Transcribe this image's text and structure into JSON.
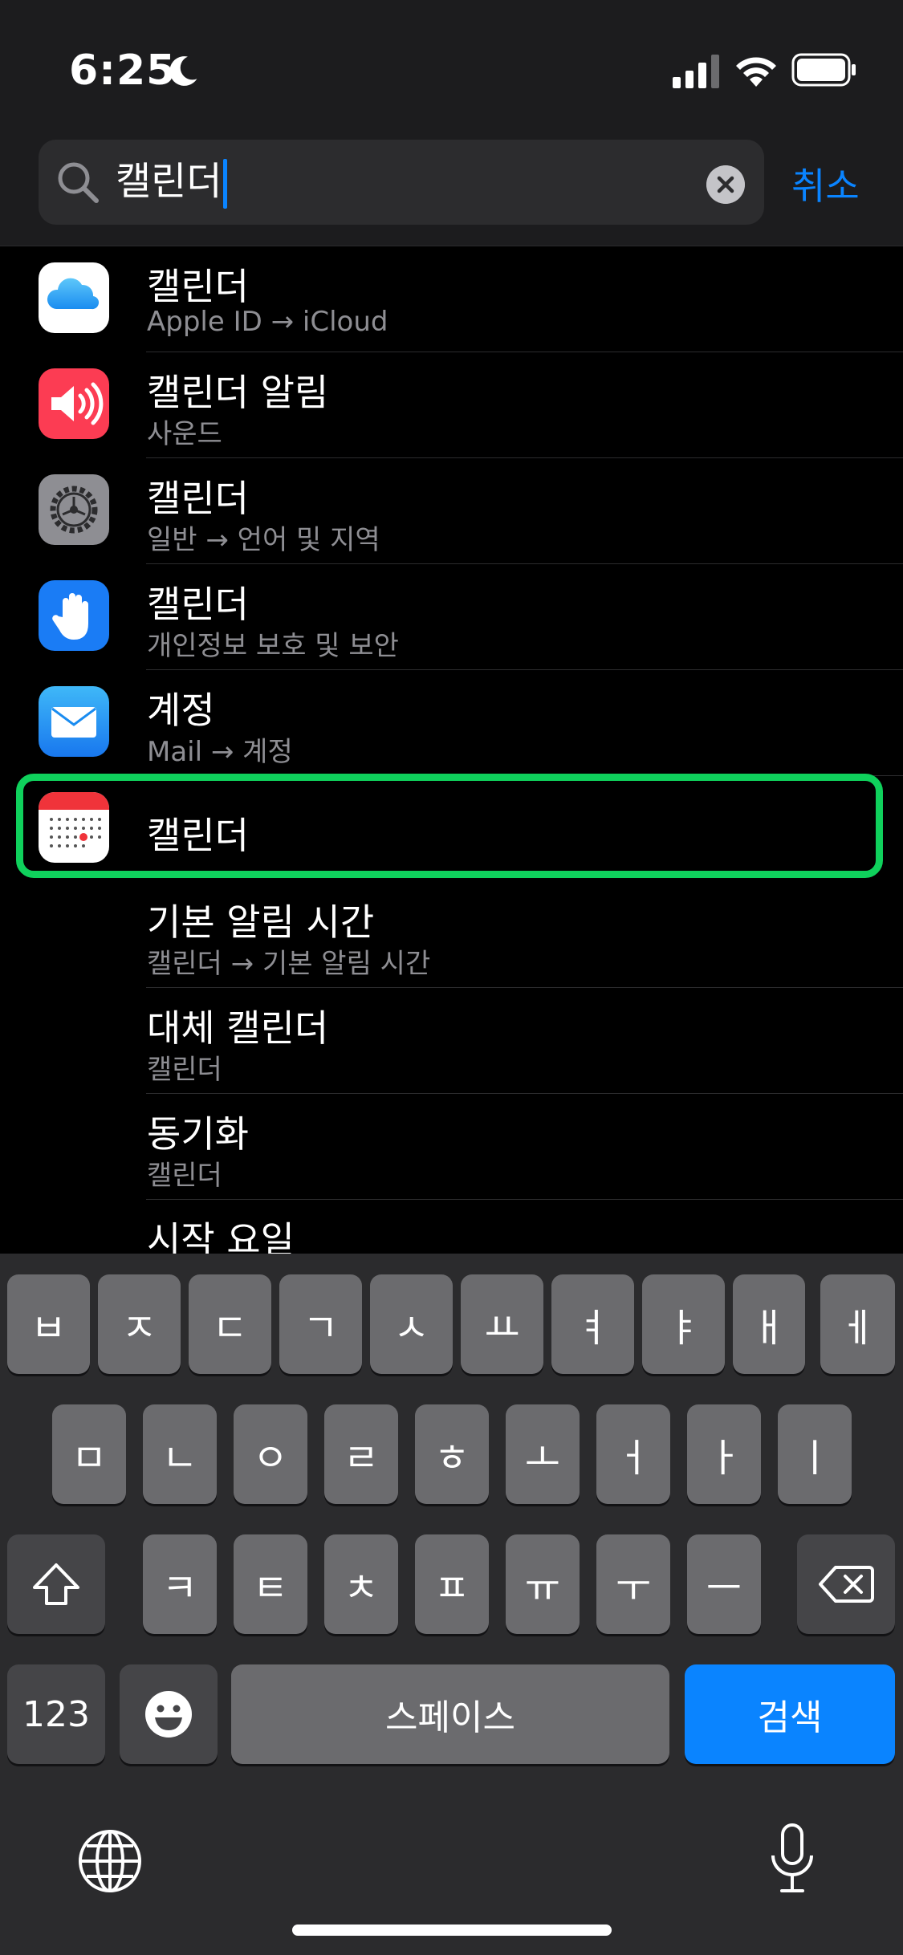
{
  "status_bar": {
    "time": "6:25",
    "icons": [
      "moon-icon",
      "signal-icon",
      "wifi-icon",
      "battery-icon"
    ]
  },
  "search": {
    "query": "캘린더",
    "cancel_label": "취소"
  },
  "results": [
    {
      "title": "캘린더",
      "subtitle": "Apple ID → iCloud",
      "icon": "icloud-icon"
    },
    {
      "title": "캘린더 알림",
      "subtitle": "사운드",
      "icon": "sound-icon"
    },
    {
      "title": "캘린더",
      "subtitle": "일반 → 언어 및 지역",
      "icon": "gear-icon"
    },
    {
      "title": "캘린더",
      "subtitle": "개인정보 보호 및 보안",
      "icon": "privacy-hand-icon"
    },
    {
      "title": "계정",
      "subtitle": "Mail → 계정",
      "icon": "mail-icon"
    },
    {
      "title": "캘린더",
      "subtitle": "",
      "icon": "calendar-icon",
      "highlighted": true
    },
    {
      "title": "기본 알림 시간",
      "subtitle": "캘린더 → 기본 알림 시간",
      "icon": ""
    },
    {
      "title": "대체 캘린더",
      "subtitle": "캘린더",
      "icon": ""
    },
    {
      "title": "동기화",
      "subtitle": "캘린더",
      "icon": ""
    },
    {
      "title": "시작 요일",
      "subtitle": "",
      "icon": ""
    }
  ],
  "keyboard": {
    "row1": [
      "ㅂ",
      "ㅈ",
      "ㄷ",
      "ㄱ",
      "ㅅ",
      "ㅛ",
      "ㅕ",
      "ㅑ",
      "ㅐ",
      "ㅔ"
    ],
    "row2": [
      "ㅁ",
      "ㄴ",
      "ㅇ",
      "ㄹ",
      "ㅎ",
      "ㅗ",
      "ㅓ",
      "ㅏ",
      "ㅣ"
    ],
    "row3": [
      "ㅋ",
      "ㅌ",
      "ㅊ",
      "ㅍ",
      "ㅠ",
      "ㅜ",
      "ㅡ"
    ],
    "numbers_label": "123",
    "space_label": "스페이스",
    "search_label": "검색"
  },
  "colors": {
    "accent": "#0a84ff",
    "highlight": "#0fd15c"
  }
}
